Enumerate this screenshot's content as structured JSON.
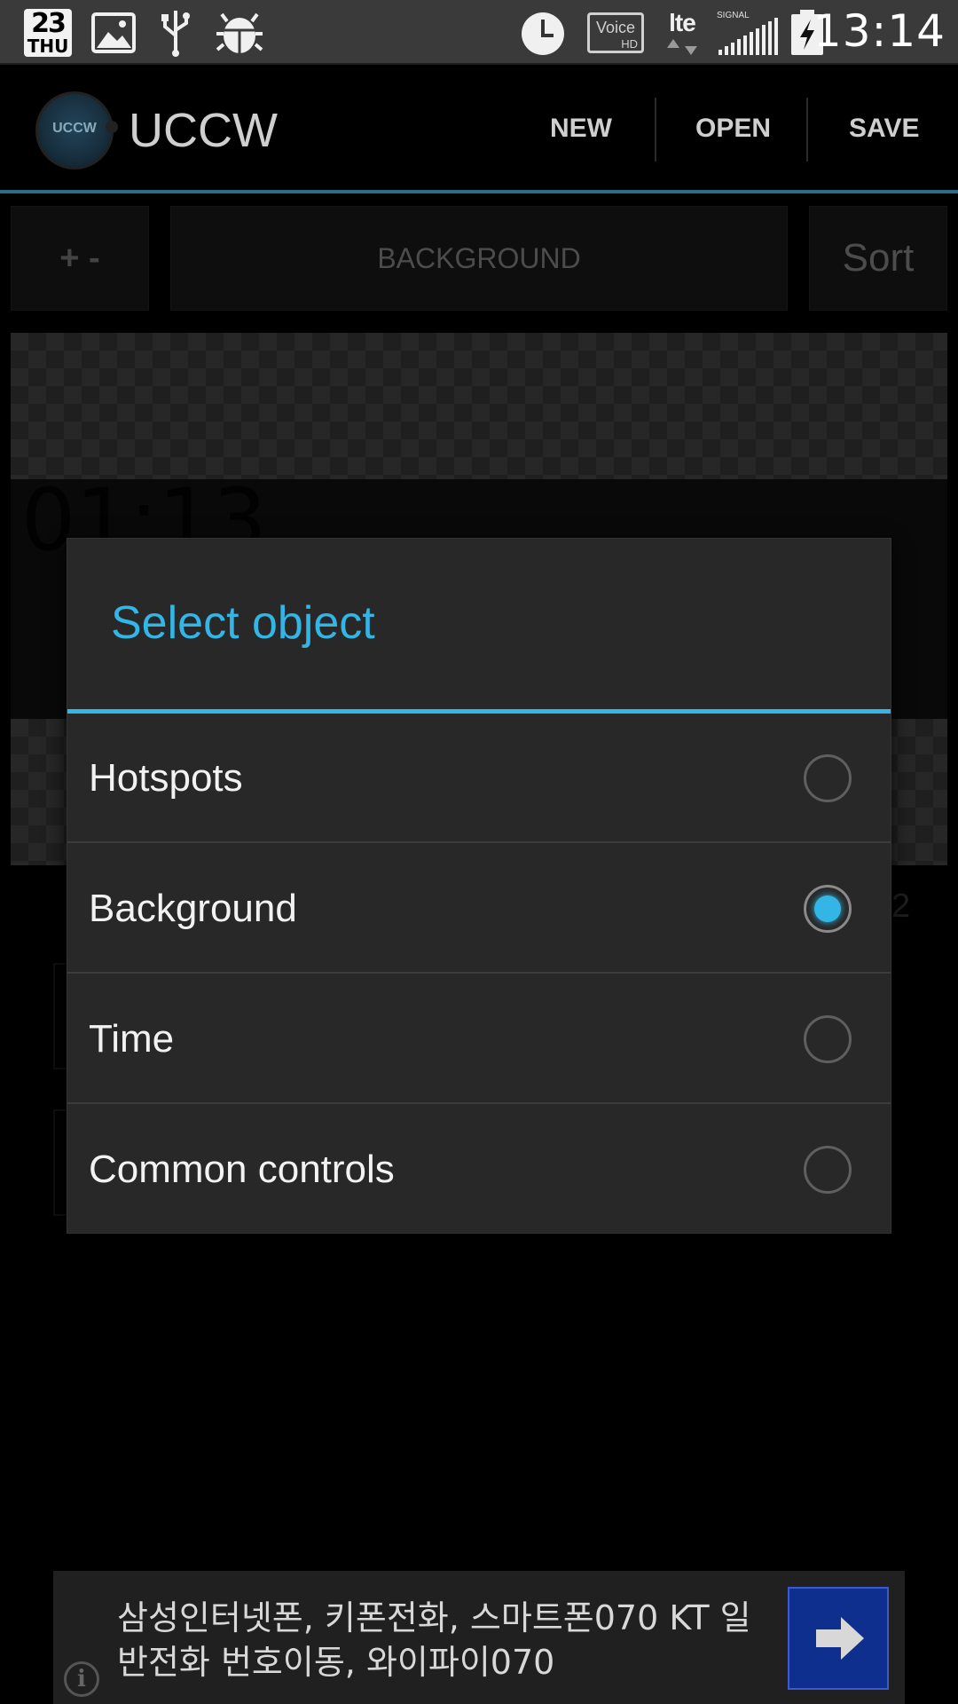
{
  "status_bar": {
    "date_day": "23",
    "date_weekday": "THU",
    "icons": [
      "date-icon",
      "gallery-icon",
      "usb-icon",
      "android-debug-icon",
      "alarm-clock-icon",
      "voice-hd-icon",
      "lte-icon",
      "signal-icon",
      "battery-charging-icon"
    ],
    "voice_label": "Voice",
    "voice_sub": "HD",
    "lte_label": "lte",
    "signal_label": "SIGNAL",
    "time": "13:14"
  },
  "action_bar": {
    "logo_text": "UCCW",
    "title": "UCCW",
    "new_label": "NEW",
    "open_label": "OPEN",
    "save_label": "SAVE",
    "accent": "#33b5e5"
  },
  "toolbar": {
    "plus_minus_label": "+ -",
    "selected_object_label": "BACKGROUND",
    "sort_label": "Sort"
  },
  "preview": {
    "time_text": "01:13",
    "peek_text": "2"
  },
  "dialog": {
    "title": "Select object",
    "options": [
      {
        "label": "Hotspots",
        "selected": false
      },
      {
        "label": "Background",
        "selected": true
      },
      {
        "label": "Time",
        "selected": false
      },
      {
        "label": "Common controls",
        "selected": false
      }
    ]
  },
  "ad": {
    "text": "삼성인터넷폰, 키폰전화, 스마트폰070 KT 일반전화 번호이동, 와이파이070",
    "info_label": "i"
  }
}
